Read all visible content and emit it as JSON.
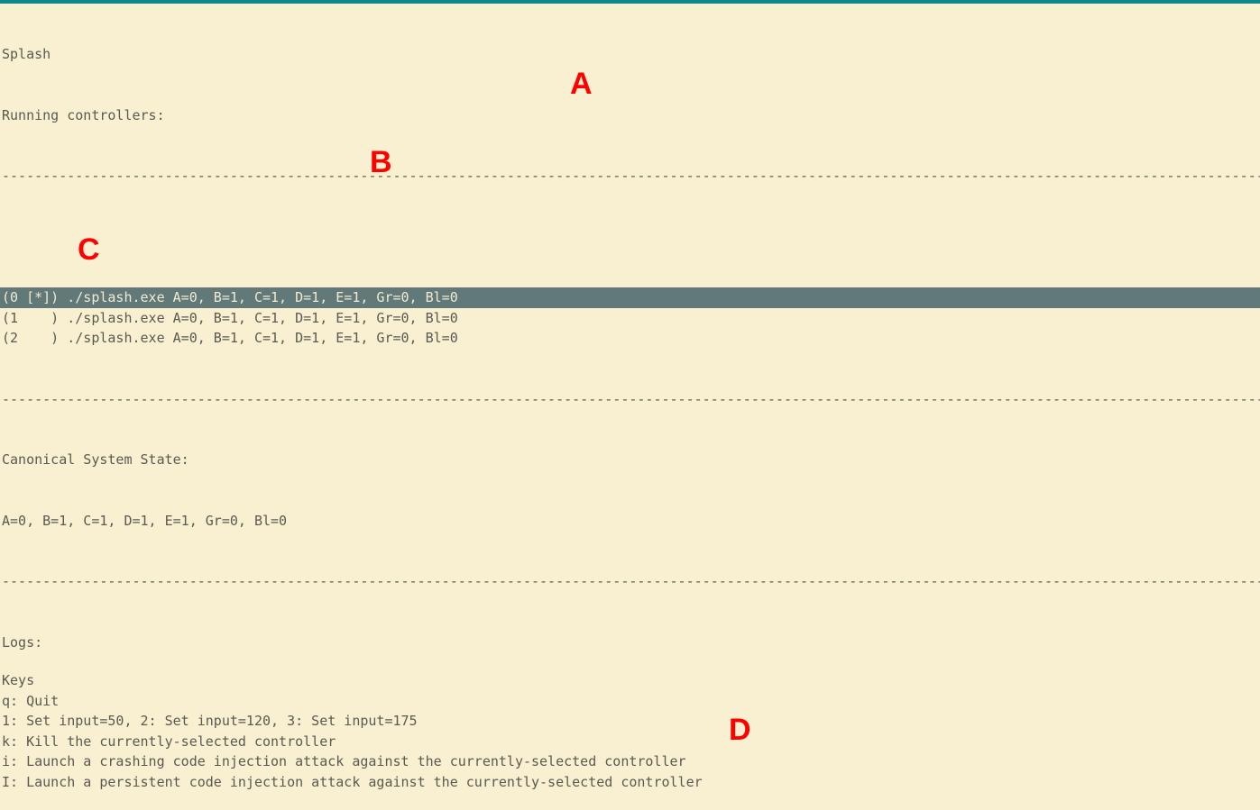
{
  "app_title": "Splash",
  "hr": "-----------------------------------------------------------------------------------------------------------------------------------------------------------------------------------",
  "controllers": {
    "header": "Running controllers:",
    "rows": [
      {
        "idx": "0",
        "marker": "[*]",
        "cmd": "./splash.exe A=0, B=1, C=1, D=1, E=1, Gr=0, Bl=0",
        "selected": true
      },
      {
        "idx": "1",
        "marker": "   ",
        "cmd": "./splash.exe A=0, B=1, C=1, D=1, E=1, Gr=0, Bl=0",
        "selected": false
      },
      {
        "idx": "2",
        "marker": "   ",
        "cmd": "./splash.exe A=0, B=1, C=1, D=1, E=1, Gr=0, Bl=0",
        "selected": false
      }
    ]
  },
  "state": {
    "header": "Canonical System State:",
    "value": "A=0, B=1, C=1, D=1, E=1, Gr=0, Bl=0"
  },
  "logs": {
    "header": "Logs:"
  },
  "keys": {
    "header": "Keys",
    "lines": [
      "q: Quit",
      "1: Set input=50, 2: Set input=120, 3: Set input=175",
      "k: Kill the currently-selected controller",
      "i: Launch a crashing code injection attack against the currently-selected controller",
      "I: Launch a persistent code injection attack against the currently-selected controller"
    ]
  },
  "annotations": {
    "a": "A",
    "b": "B",
    "c": "C",
    "d": "D"
  }
}
